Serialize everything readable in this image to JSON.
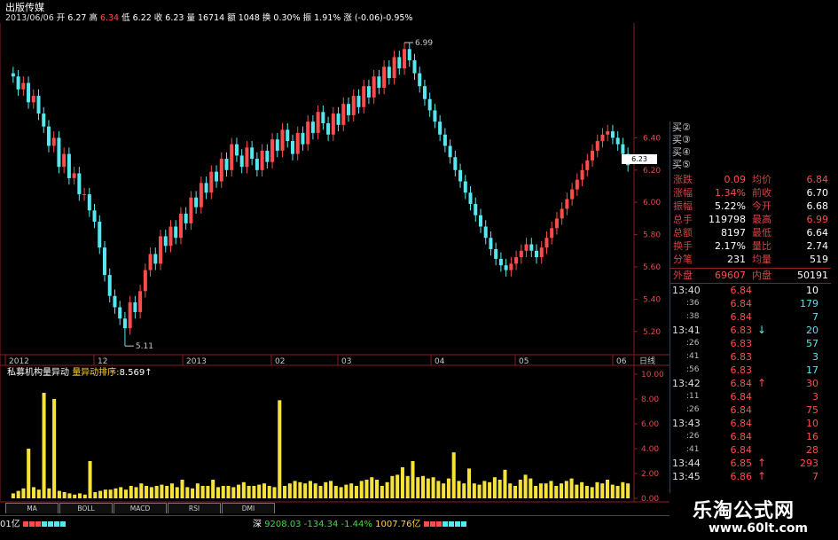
{
  "header": {
    "stock_name": "出版传媒",
    "date": "2013/06/06",
    "open_label": "开",
    "open": "6.27",
    "high_label": "高",
    "high": "6.34",
    "low_label": "低",
    "low": "6.22",
    "close_label": "收",
    "close": "6.23",
    "vol_label": "量",
    "vol": "16714",
    "amount_label": "额",
    "amount": "1048",
    "turnover_label": "换",
    "turnover": "0.30%",
    "amplitude_label": "振",
    "amplitude": "1.91%",
    "change_label": "涨",
    "change": "(-0.06)-0.95%"
  },
  "chart_data": [
    {
      "type": "candlestick",
      "y_ticks": [
        "6.40",
        "6.20",
        "6.00",
        "5.80",
        "5.60",
        "5.40",
        "5.20"
      ],
      "ylim": [
        5.1,
        7.1
      ],
      "x_labels": [
        "2012",
        "12",
        "2013",
        "02",
        "03",
        "04",
        "05",
        "06"
      ],
      "period_label": "日线",
      "annotations": {
        "high": "6.99",
        "low": "5.11",
        "last_price": "6.23"
      },
      "closes": [
        6.78,
        6.7,
        6.74,
        6.62,
        6.66,
        6.55,
        6.47,
        6.35,
        6.4,
        6.22,
        6.3,
        6.15,
        6.18,
        6.05,
        6.05,
        5.95,
        5.88,
        5.72,
        5.55,
        5.42,
        5.35,
        5.28,
        5.22,
        5.38,
        5.32,
        5.45,
        5.58,
        5.68,
        5.62,
        5.79,
        5.73,
        5.85,
        5.78,
        5.93,
        5.87,
        6.03,
        5.97,
        6.12,
        6.06,
        6.19,
        6.13,
        6.27,
        6.2,
        6.36,
        6.29,
        6.22,
        6.34,
        6.27,
        6.2,
        6.32,
        6.25,
        6.39,
        6.32,
        6.45,
        6.38,
        6.3,
        6.43,
        6.36,
        6.5,
        6.43,
        6.56,
        6.49,
        6.42,
        6.55,
        6.48,
        6.61,
        6.54,
        6.66,
        6.59,
        6.72,
        6.65,
        6.78,
        6.71,
        6.84,
        6.77,
        6.9,
        6.83,
        6.95,
        6.88,
        6.8,
        6.72,
        6.64,
        6.57,
        6.5,
        6.42,
        6.35,
        6.28,
        6.2,
        6.13,
        6.06,
        5.99,
        5.92,
        5.85,
        5.78,
        5.71,
        5.65,
        5.61,
        5.58,
        5.62,
        5.66,
        5.7,
        5.74,
        5.7,
        5.66,
        5.72,
        5.78,
        5.84,
        5.9,
        5.96,
        6.02,
        6.08,
        6.14,
        6.2,
        6.26,
        6.32,
        6.38,
        6.42,
        6.44,
        6.4,
        6.36,
        6.3,
        6.23
      ],
      "volume_ticks": [
        "10.00",
        "8.00",
        "6.00",
        "4.00",
        "2.00",
        "0.00"
      ],
      "volume_ylim": [
        0,
        10
      ],
      "volumes": [
        0.4,
        0.6,
        0.8,
        4.0,
        0.9,
        0.7,
        8.5,
        0.8,
        8.0,
        0.6,
        0.5,
        0.4,
        0.3,
        0.4,
        0.3,
        3.0,
        0.5,
        0.6,
        0.7,
        0.7,
        0.8,
        0.9,
        0.7,
        1.0,
        0.9,
        1.2,
        1.0,
        0.9,
        1.0,
        1.1,
        1.0,
        1.2,
        0.9,
        1.5,
        0.9,
        0.8,
        1.2,
        1.0,
        1.0,
        1.5,
        0.9,
        1.0,
        1.0,
        0.9,
        1.1,
        1.3,
        1.0,
        1.0,
        1.1,
        1.2,
        1.0,
        0.9,
        7.9,
        1.0,
        1.2,
        1.4,
        1.3,
        1.2,
        1.4,
        1.2,
        1.0,
        1.3,
        1.4,
        1.0,
        0.9,
        1.1,
        1.2,
        1.0,
        1.4,
        1.5,
        1.7,
        1.5,
        1.0,
        1.3,
        1.8,
        1.9,
        2.5,
        1.8,
        3.0,
        1.7,
        1.8,
        1.6,
        1.7,
        1.4,
        1.2,
        1.6,
        3.7,
        1.4,
        1.2,
        2.4,
        1.2,
        1.1,
        1.4,
        1.3,
        1.7,
        1.5,
        2.3,
        1.2,
        1.0,
        1.5,
        1.9,
        1.6,
        1.0,
        1.2,
        1.2,
        1.4,
        1.0,
        1.2,
        1.4,
        1.6,
        1.1,
        1.3,
        1.0,
        0.9,
        1.3,
        1.2,
        1.5,
        1.1,
        1.0,
        1.3,
        1.2
      ]
    }
  ],
  "indicator": {
    "name": "私募机构量异动",
    "series_label": "量异动排序:",
    "series_value": "8.569",
    "arrow": "↑"
  },
  "tabs": [
    "MA",
    "BOLL",
    "MACD",
    "RSI",
    "DMI"
  ],
  "status_bar": {
    "left_amount": "01亿",
    "market": "深",
    "index_value": "9208.03",
    "index_change": "-134.34",
    "index_pct": "-1.44%",
    "turnover": "1007.76亿"
  },
  "bids": [
    {
      "label": "买②"
    },
    {
      "label": "买③"
    },
    {
      "label": "买④"
    },
    {
      "label": "买⑤"
    }
  ],
  "stats": [
    {
      "l1": "涨跌",
      "v1": "0.09",
      "l2": "均价",
      "v2": "6.84"
    },
    {
      "l1": "涨幅",
      "v1": "1.34%",
      "l2": "前收",
      "v2": "6.70"
    },
    {
      "l1": "振幅",
      "v1": "5.22%",
      "l2": "今开",
      "v2": "6.68"
    },
    {
      "l1": "总手",
      "v1": "119798",
      "l2": "最高",
      "v2": "6.99"
    },
    {
      "l1": "总额",
      "v1": "8197",
      "l2": "最低",
      "v2": "6.64"
    },
    {
      "l1": "换手",
      "v1": "2.17%",
      "l2": "量比",
      "v2": "2.74"
    },
    {
      "l1": "分笔",
      "v1": "231",
      "l2": "均量",
      "v2": "519"
    }
  ],
  "waipan": {
    "label": "外盘",
    "value": "69607",
    "label2": "内盘",
    "value2": "50191"
  },
  "ticks": [
    {
      "time": "13:40",
      "price": "6.84",
      "arrow": "",
      "vol": "10",
      "vol_color": "#ffffff"
    },
    {
      "time": ":36",
      "price": "6.84",
      "arrow": "",
      "vol": "179",
      "vol_color": "#56e8f0"
    },
    {
      "time": ":38",
      "price": "6.84",
      "arrow": "",
      "vol": "7",
      "vol_color": "#56e8f0"
    },
    {
      "time": "13:41",
      "price": "6.83",
      "arrow": "↓",
      "vol": "20",
      "vol_color": "#56e8f0"
    },
    {
      "time": ":26",
      "price": "6.83",
      "arrow": "",
      "vol": "57",
      "vol_color": "#56e8f0"
    },
    {
      "time": ":41",
      "price": "6.83",
      "arrow": "",
      "vol": "3",
      "vol_color": "#56e8f0"
    },
    {
      "time": ":56",
      "price": "6.83",
      "arrow": "",
      "vol": "17",
      "vol_color": "#56e8f0"
    },
    {
      "time": "13:42",
      "price": "6.84",
      "arrow": "↑",
      "vol": "30",
      "vol_color": "#ff4b4b"
    },
    {
      "time": ":11",
      "price": "6.84",
      "arrow": "",
      "vol": "3",
      "vol_color": "#ff4b4b"
    },
    {
      "time": ":26",
      "price": "6.84",
      "arrow": "",
      "vol": "75",
      "vol_color": "#ff4b4b"
    },
    {
      "time": "13:43",
      "price": "6.84",
      "arrow": "",
      "vol": "10",
      "vol_color": "#ff4b4b"
    },
    {
      "time": ":26",
      "price": "6.84",
      "arrow": "",
      "vol": "16",
      "vol_color": "#ff4b4b"
    },
    {
      "time": ":41",
      "price": "6.84",
      "arrow": "",
      "vol": "28",
      "vol_color": "#ff4b4b"
    },
    {
      "time": "13:44",
      "price": "6.85",
      "arrow": "↑",
      "vol": "293",
      "vol_color": "#ff4b4b"
    },
    {
      "time": "13:45",
      "price": "6.86",
      "arrow": "↑",
      "vol": "7",
      "vol_color": "#ff4b4b"
    }
  ],
  "watermark": {
    "title": "乐淘公式网",
    "url": "www.60lt.com"
  },
  "colors": {
    "up": "#ff4b4b",
    "down": "#56e8f0",
    "volume": "#f5e23a",
    "axis": "#8b1e1e"
  }
}
